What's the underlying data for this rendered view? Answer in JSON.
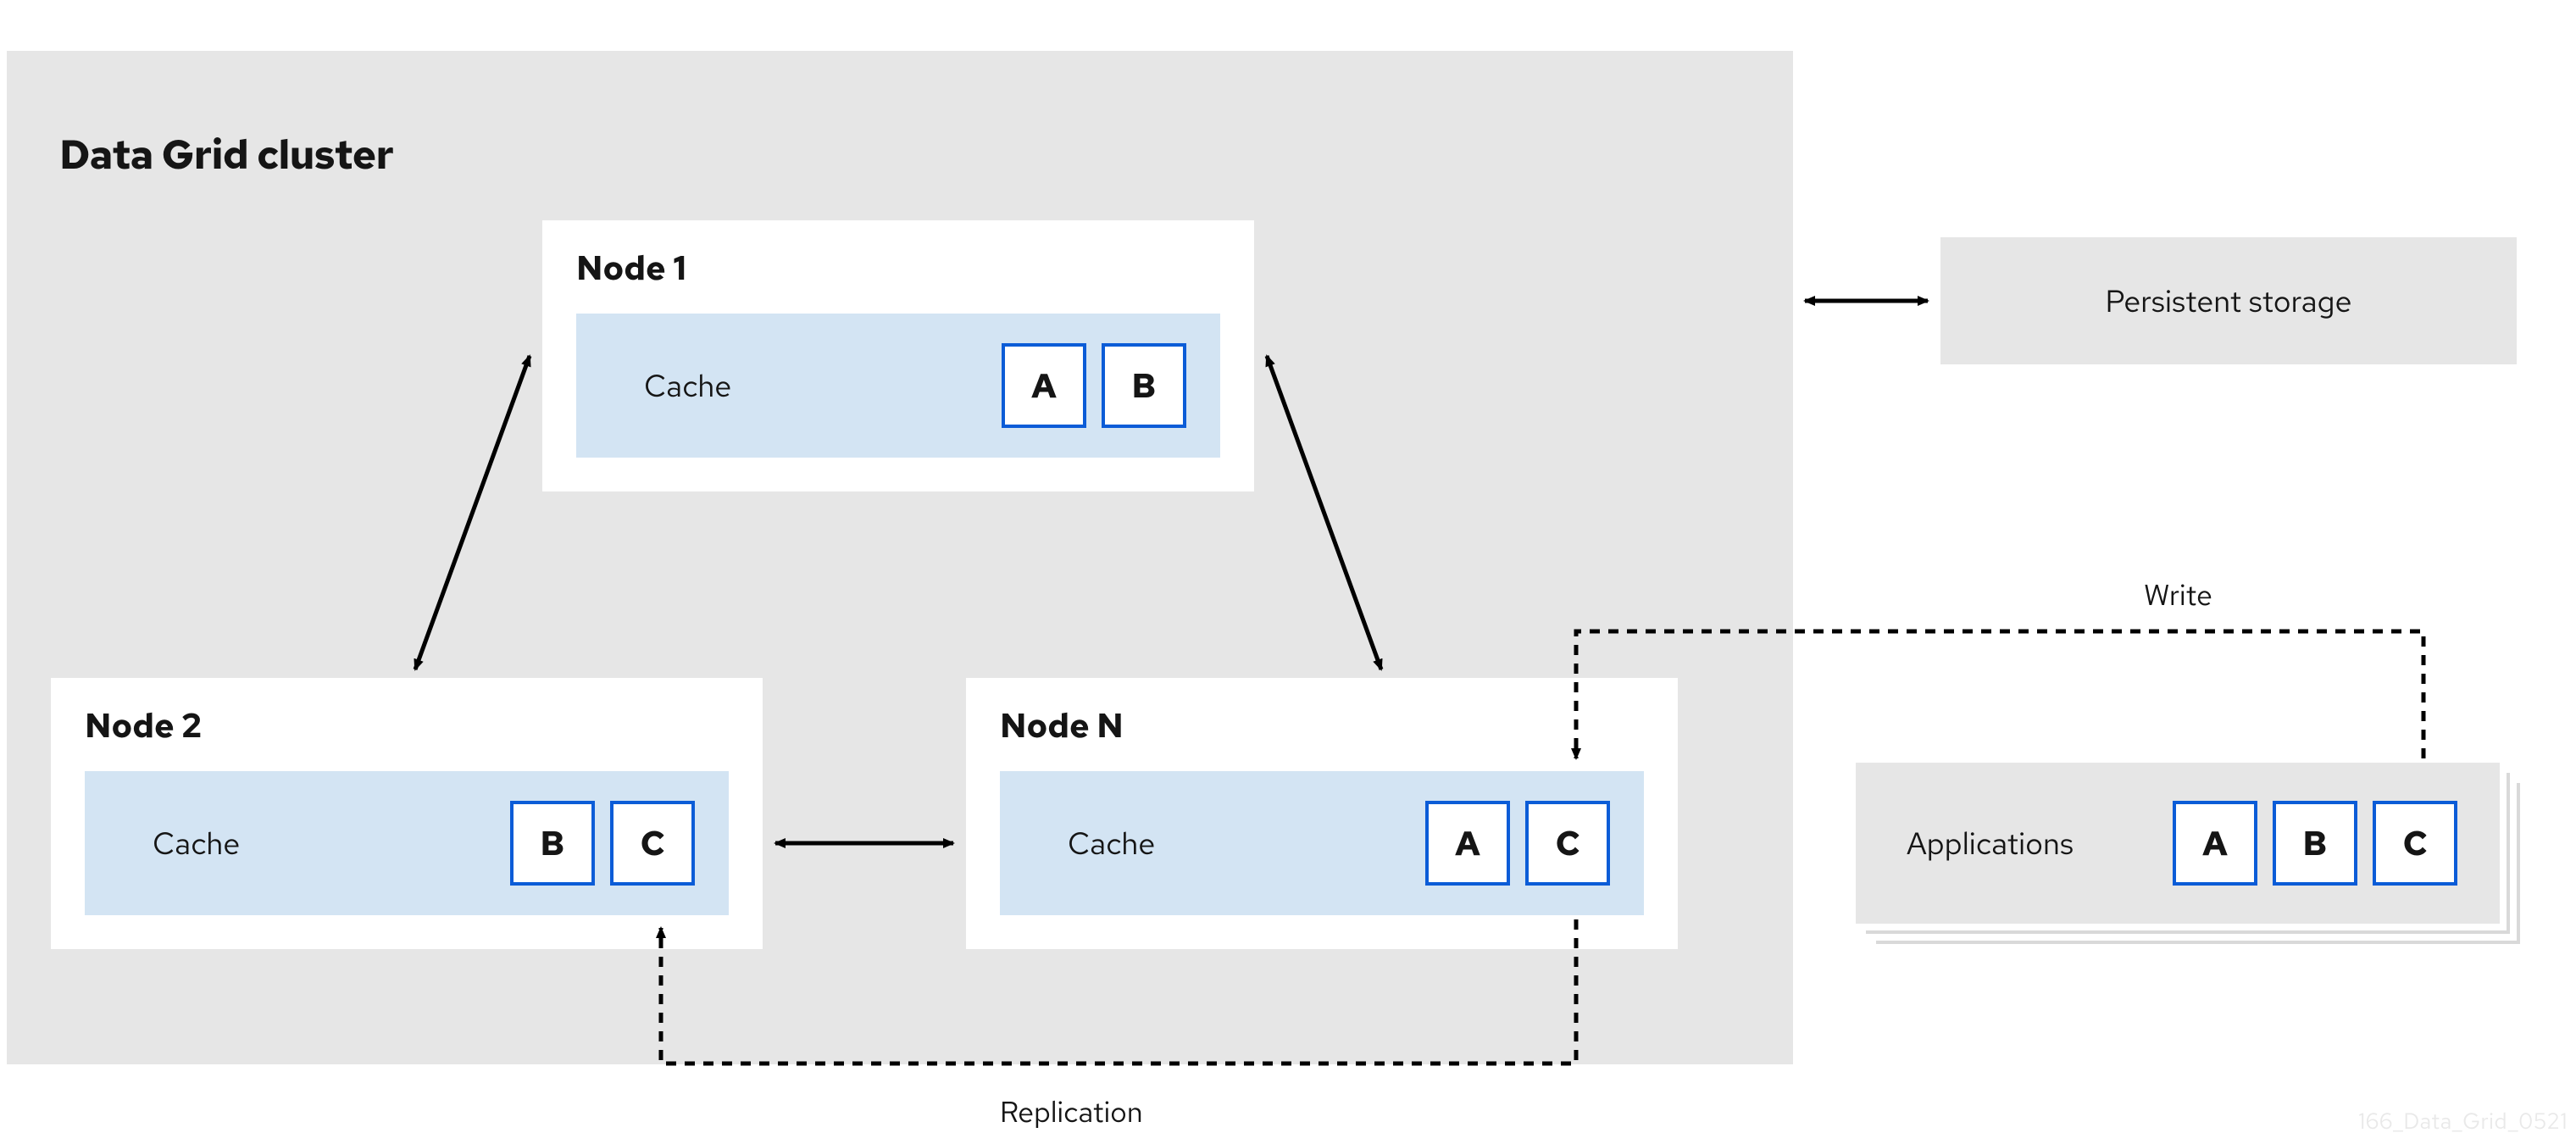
{
  "diagram": {
    "cluster_title": "Data Grid cluster",
    "cache_label": "Cache",
    "nodes": {
      "node1": {
        "title": "Node 1",
        "entries": [
          "A",
          "B"
        ]
      },
      "node2": {
        "title": "Node 2",
        "entries": [
          "B",
          "C"
        ]
      },
      "nodeN": {
        "title": "Node N",
        "entries": [
          "A",
          "C"
        ]
      }
    },
    "persistent_storage": "Persistent storage",
    "applications": {
      "label": "Applications",
      "entries": [
        "A",
        "B",
        "C"
      ]
    },
    "labels": {
      "write": "Write",
      "replication": "Replication"
    },
    "watermark": "166_Data_Grid_0521"
  }
}
